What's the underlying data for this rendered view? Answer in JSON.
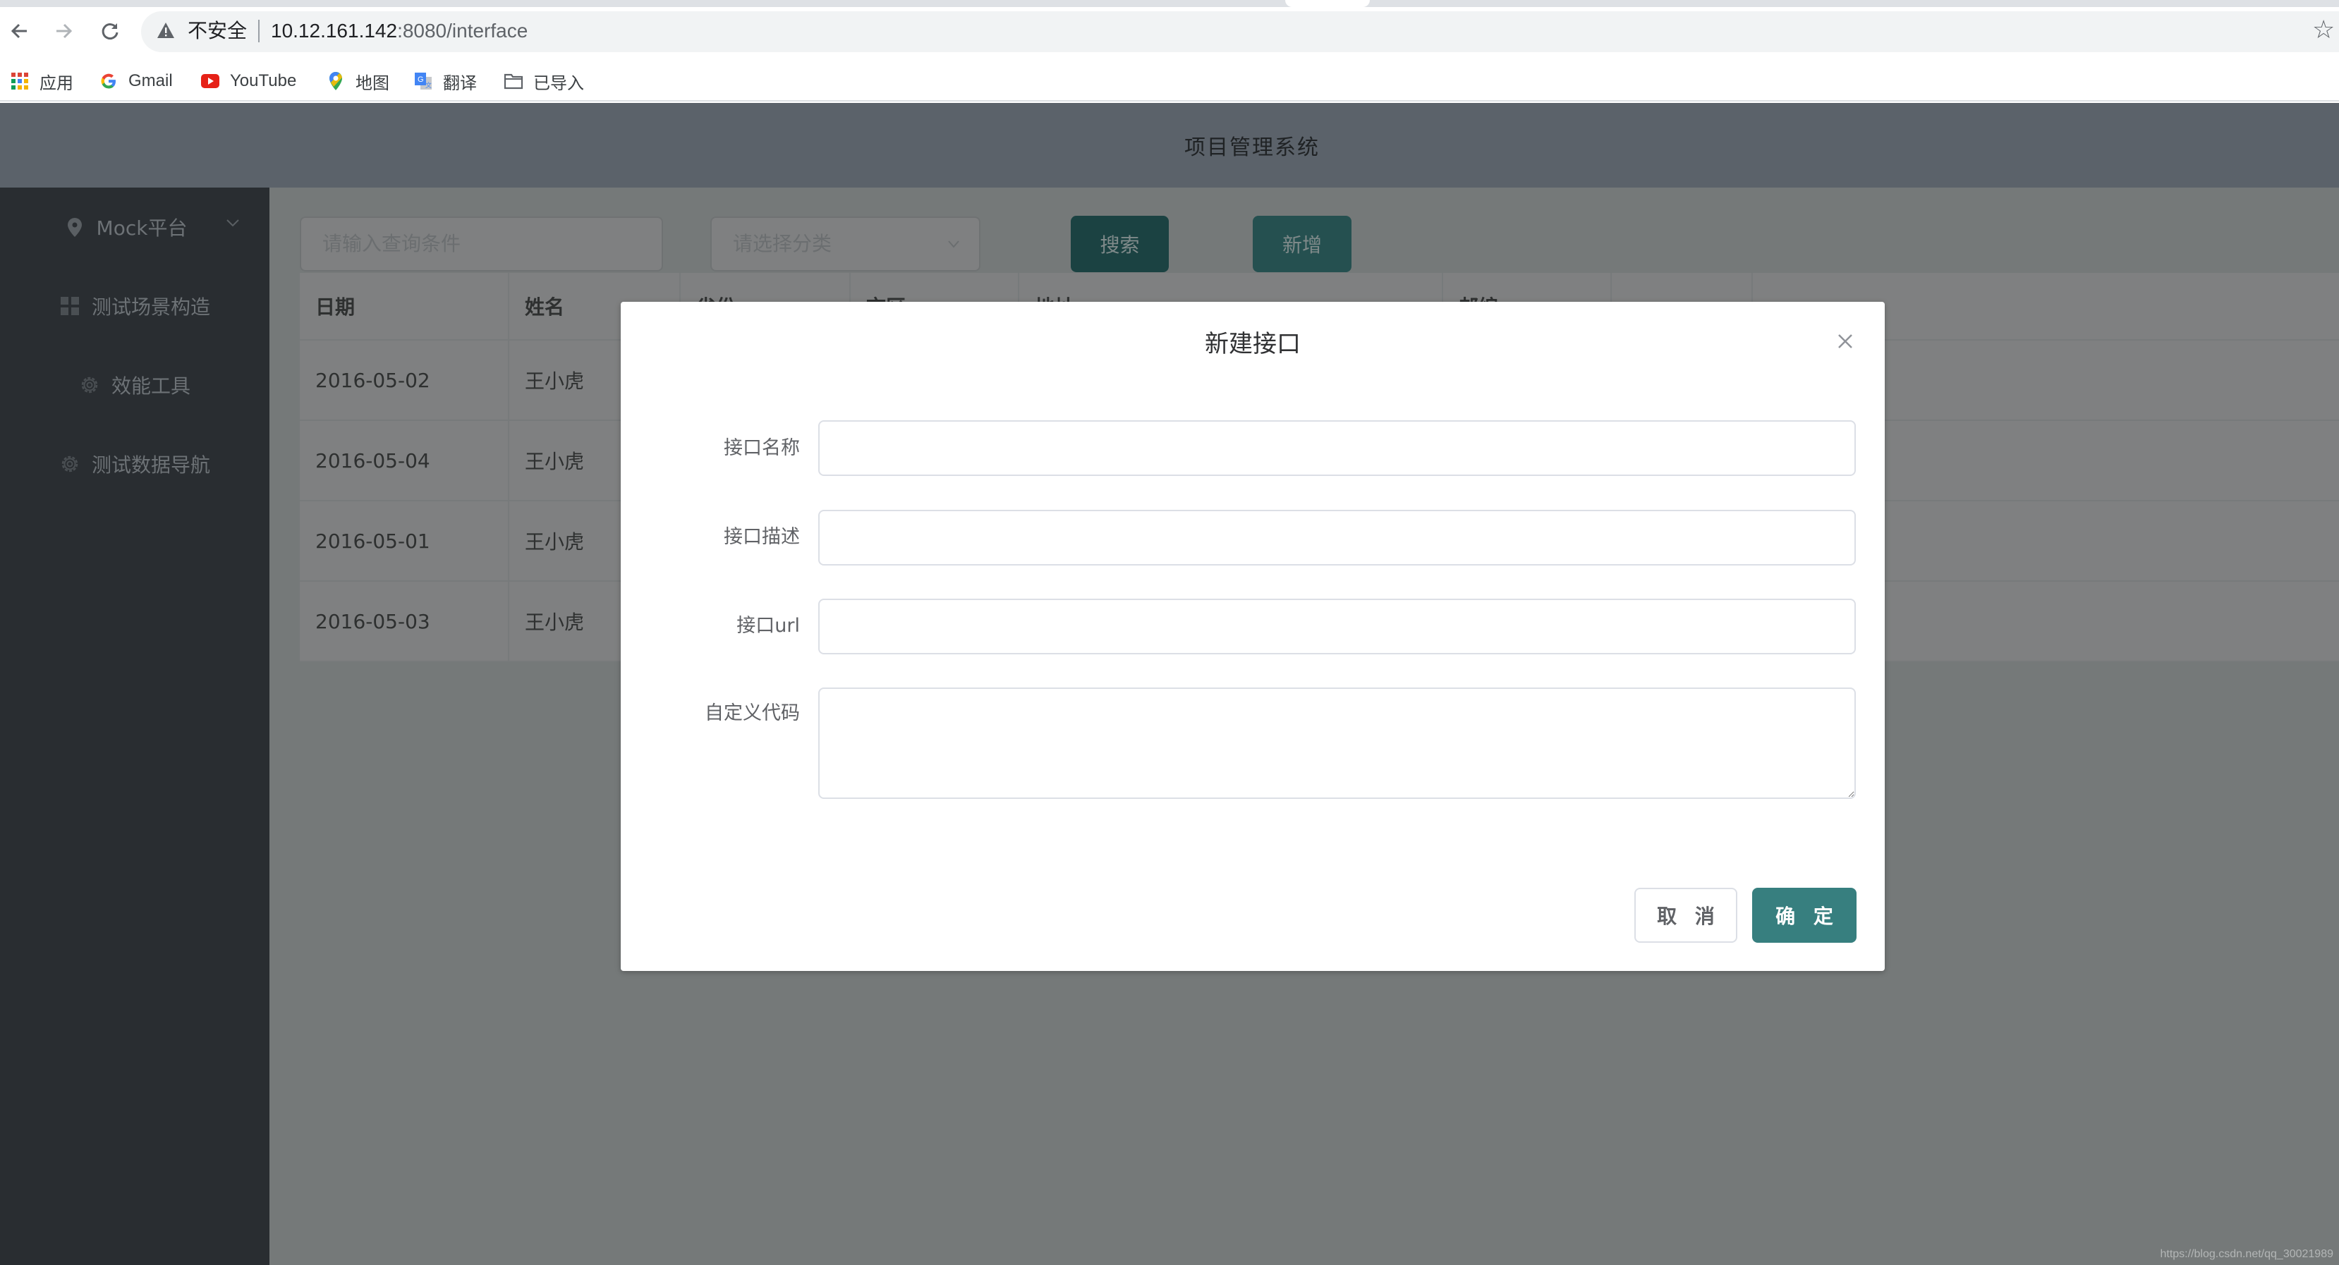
{
  "browser": {
    "security_label": "不安全",
    "url_host": "10.12.161.142",
    "url_rest": ":8080/interface",
    "nav": {
      "back": "back-icon",
      "forward": "forward-icon",
      "reload": "reload-icon"
    },
    "bookmarks": [
      {
        "label": "应用",
        "icon": "apps-grid-icon"
      },
      {
        "label": "Gmail",
        "icon": "google-icon"
      },
      {
        "label": "YouTube",
        "icon": "youtube-icon"
      },
      {
        "label": "地图",
        "icon": "maps-pin-icon"
      },
      {
        "label": "翻译",
        "icon": "translate-icon"
      },
      {
        "label": "已导入",
        "icon": "folder-icon"
      }
    ]
  },
  "app": {
    "title": "项目管理系统"
  },
  "sidebar": {
    "items": [
      {
        "label": "Mock平台",
        "icon": "location-pin-icon",
        "has_submenu": true
      },
      {
        "label": "测试场景构造",
        "icon": "grid-icon"
      },
      {
        "label": "效能工具",
        "icon": "gear-icon"
      },
      {
        "label": "测试数据导航",
        "icon": "gear-icon"
      }
    ]
  },
  "toolbar": {
    "search_placeholder": "请输入查询条件",
    "category_placeholder": "请选择分类",
    "search_label": "搜索",
    "add_label": "新增"
  },
  "table": {
    "columns": [
      "日期",
      "姓名",
      "省份",
      "市区",
      "地址",
      "邮编",
      ""
    ],
    "rows": [
      {
        "date": "2016-05-02",
        "name": "王小虎"
      },
      {
        "date": "2016-05-04",
        "name": "王小虎"
      },
      {
        "date": "2016-05-01",
        "name": "王小虎"
      },
      {
        "date": "2016-05-03",
        "name": "王小虎"
      }
    ]
  },
  "modal": {
    "title": "新建接口",
    "fields": [
      {
        "label": "接口名称",
        "value": "",
        "placeholder": ""
      },
      {
        "label": "接口描述",
        "value": "",
        "placeholder": ""
      },
      {
        "label": "接口url",
        "value": "",
        "placeholder": ""
      },
      {
        "label": "自定义代码",
        "value": "",
        "placeholder": ""
      }
    ],
    "cancel_label": "取 消",
    "confirm_label": "确 定"
  },
  "colors": {
    "primary": "#377f7f",
    "header_bg": "#5b626a",
    "sidebar_bg": "#292d31"
  },
  "watermark": "https://blog.csdn.net/qq_30021989"
}
